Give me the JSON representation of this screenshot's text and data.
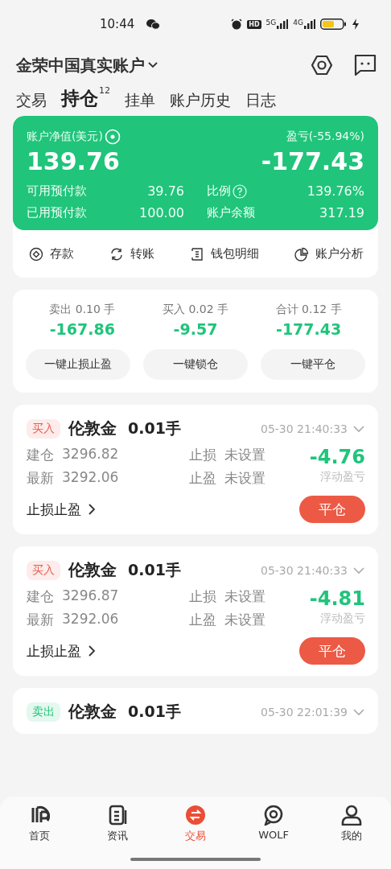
{
  "status_bar": {
    "time": "10:44",
    "hd": "HD",
    "networks": [
      "5G",
      "4G"
    ]
  },
  "header": {
    "account": "金荣中国真实账户"
  },
  "tabs": [
    {
      "label": "交易",
      "selected": false
    },
    {
      "label": "持仓",
      "selected": true,
      "badge": "12"
    },
    {
      "label": "挂单",
      "selected": false
    },
    {
      "label": "账户历史",
      "selected": false
    },
    {
      "label": "日志",
      "selected": false
    }
  ],
  "equity_card": {
    "equity_label": "账户净值(美元)",
    "equity": "139.76",
    "pnl_label": "盈亏(-55.94%)",
    "pnl": "-177.43",
    "stats": [
      {
        "label": "可用预付款",
        "value": "39.76"
      },
      {
        "label": "比例",
        "value": "139.76%",
        "help": true
      },
      {
        "label": "已用预付款",
        "value": "100.00"
      },
      {
        "label": "账户余额",
        "value": "317.19"
      }
    ]
  },
  "actions": [
    {
      "kind": "deposit",
      "label": "存款"
    },
    {
      "kind": "transfer",
      "label": "转账"
    },
    {
      "kind": "wallet",
      "label": "钱包明细"
    },
    {
      "kind": "analysis",
      "label": "账户分析"
    }
  ],
  "summary": {
    "columns": [
      {
        "side": "卖出",
        "lots": "0.10",
        "unit": "手",
        "value": "-167.86"
      },
      {
        "side": "买入",
        "lots": "0.02",
        "unit": "手",
        "value": "-9.57"
      },
      {
        "side": "合计",
        "lots": "0.12",
        "unit": "手",
        "value": "-177.43"
      }
    ],
    "buttons": [
      "一键止损止盈",
      "一键锁仓",
      "一键平仓"
    ]
  },
  "positions": [
    {
      "kind": "buy",
      "tag": "买入",
      "symbol": "伦敦金",
      "lots": "0.01手",
      "time": "05-30 21:40:33",
      "open_label": "建仓",
      "open": "3296.82",
      "last_label": "最新",
      "last": "3292.06",
      "sl_label": "止损",
      "sl": "未设置",
      "tp_label": "止盈",
      "tp": "未设置",
      "pnl": "-4.76",
      "pnl_label": "浮动盈亏",
      "sltp_link": "止损止盈",
      "close_button": "平仓"
    },
    {
      "kind": "buy",
      "tag": "买入",
      "symbol": "伦敦金",
      "lots": "0.01手",
      "time": "05-30 21:40:33",
      "open_label": "建仓",
      "open": "3296.87",
      "last_label": "最新",
      "last": "3292.06",
      "sl_label": "止损",
      "sl": "未设置",
      "tp_label": "止盈",
      "tp": "未设置",
      "pnl": "-4.81",
      "pnl_label": "浮动盈亏",
      "sltp_link": "止损止盈",
      "close_button": "平仓"
    },
    {
      "kind": "sell",
      "tag": "卖出",
      "symbol": "伦敦金",
      "lots": "0.01手",
      "time": "05-30 22:01:39"
    }
  ],
  "bottom_nav": [
    {
      "kind": "home",
      "label": "首页",
      "selected": false
    },
    {
      "kind": "news",
      "label": "资讯",
      "selected": false
    },
    {
      "kind": "trade",
      "label": "交易",
      "selected": true
    },
    {
      "kind": "wolf",
      "label": "WOLF",
      "selected": false
    },
    {
      "kind": "me",
      "label": "我的",
      "selected": false
    }
  ]
}
